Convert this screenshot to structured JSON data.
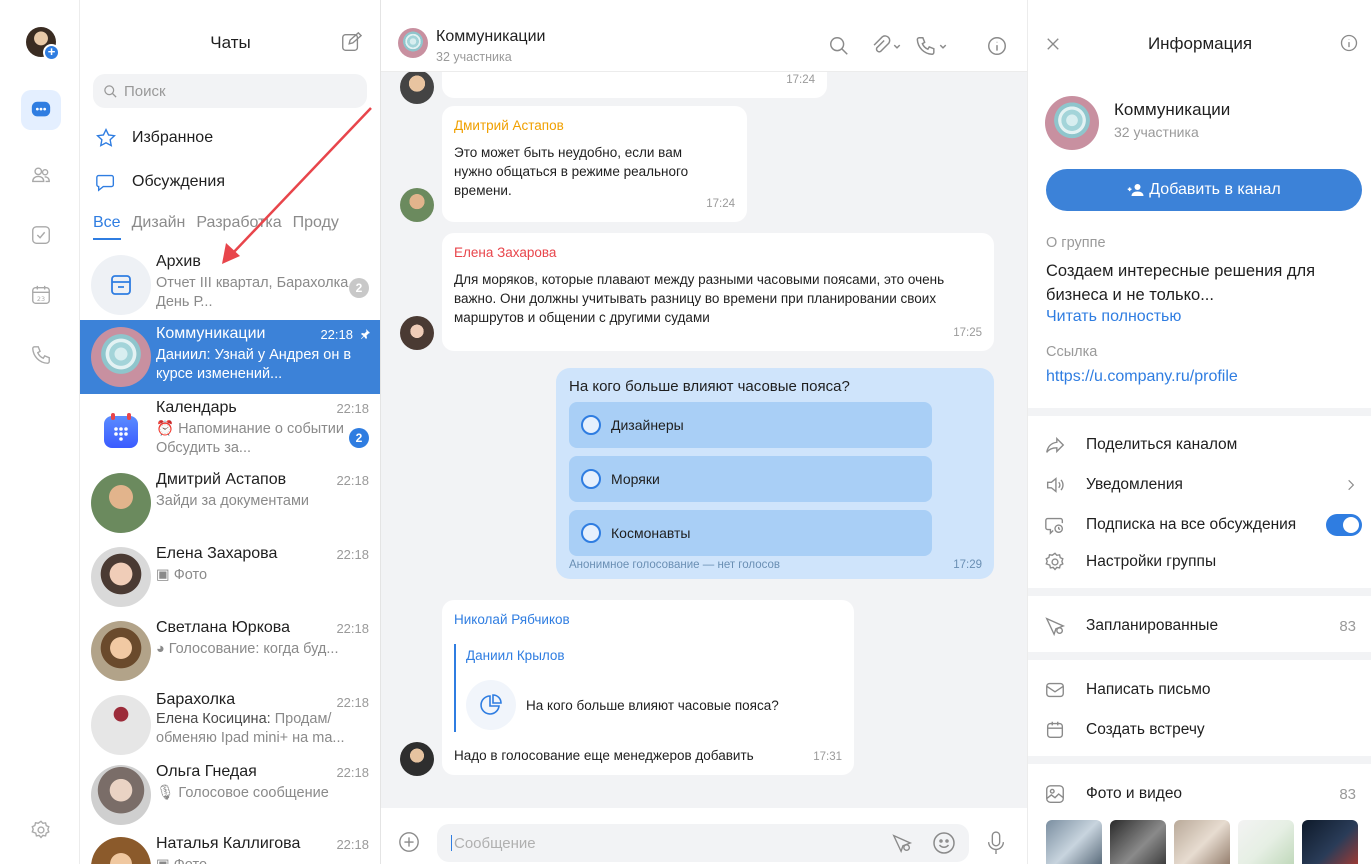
{
  "chats_panel": {
    "title": "Чаты",
    "search_placeholder": "Поиск",
    "favorites": "Избранное",
    "discussions": "Обсуждения",
    "tabs": [
      "Все",
      "Дизайн",
      "Разработка",
      "Проду"
    ]
  },
  "chat_list": [
    {
      "name": "Архив",
      "time": "",
      "preview": "Отчет III квартал, Барахолка, День Р...",
      "badge": "2"
    },
    {
      "name": "Коммуникации",
      "time": "22:18",
      "preview": "Даниил: Узнай у Андрея он в курсе изменений...",
      "badge": ""
    },
    {
      "name": "Календарь",
      "time": "22:18",
      "preview": "⏰ Напоминание о событии Обсудить за...",
      "badge": "2"
    },
    {
      "name": "Дмитрий Астапов",
      "time": "22:18",
      "preview": "Зайди за документами",
      "badge": ""
    },
    {
      "name": "Елена Захарова",
      "time": "22:18",
      "preview": "▣ Фото",
      "badge": ""
    },
    {
      "name": "Светлана Юркова",
      "time": "22:18",
      "preview": "◕ Голосование: когда буд...",
      "badge": ""
    },
    {
      "name": "Барахолка",
      "time": "22:18",
      "preview_author": "Елена Косицина:",
      "preview": "Продам/ обменяю Ipad mini+ на ma...",
      "badge": ""
    },
    {
      "name": "Ольга Гнедая",
      "time": "22:18",
      "preview": "🎙 Голосовое сообщение",
      "badge": ""
    },
    {
      "name": "Наталья Каллигова",
      "time": "22:18",
      "preview": "▣ Фото",
      "badge": ""
    }
  ],
  "conversation": {
    "title": "Коммуникации",
    "subtitle": "32 участника",
    "top_time": "17:24",
    "messages": [
      {
        "author": "Дмитрий Астапов",
        "author_color": "#f0a000",
        "text": "Это может быть неудобно, если вам нужно общаться в режиме реального времени.",
        "time": "17:24"
      },
      {
        "author": "Елена Захарова",
        "author_color": "#e8454b",
        "text": "Для моряков, которые плавают между разными часовыми поясами, это очень важно. Они должны учитывать разницу во времени при планировании своих маршрутов и общении с другими судами",
        "time": "17:25"
      }
    ],
    "poll": {
      "question": "На кого больше влияют часовые пояса?",
      "options": [
        "Дизайнеры",
        "Моряки",
        "Космонавты"
      ],
      "footer": "Анонимное голосование — нет голосов",
      "time": "17:29"
    },
    "reply_message": {
      "author": "Николай Рябчиков",
      "quoted_author": "Даниил Крылов",
      "quoted_text": "На кого больше влияют часовые пояса?",
      "text": "Надо в голосование еще менеджеров добавить",
      "time": "17:31"
    },
    "composer_placeholder": "Сообщение"
  },
  "info_panel": {
    "title": "Информация",
    "group_name": "Коммуникации",
    "group_sub": "32 участника",
    "add_button": "Добавить в канал",
    "about_label": "О группе",
    "about_text": "Создаем интересные решения для бизнеса и не только...",
    "read_more": "Читать полностью",
    "link_label": "Ссылка",
    "link": "https://u.company.ru/profile",
    "share": "Поделиться каналом",
    "notifications": "Уведомления",
    "subscribe": "Подписка на все обсуждения",
    "settings": "Настройки группы",
    "scheduled": "Запланированные",
    "scheduled_count": "83",
    "write_email": "Написать письмо",
    "create_meeting": "Создать встречу",
    "media": "Фото и видео",
    "media_count": "83"
  },
  "colors": {
    "accent": "#2f7de1",
    "selected": "#3c82d8",
    "poll_bg": "#cfe4fb"
  }
}
